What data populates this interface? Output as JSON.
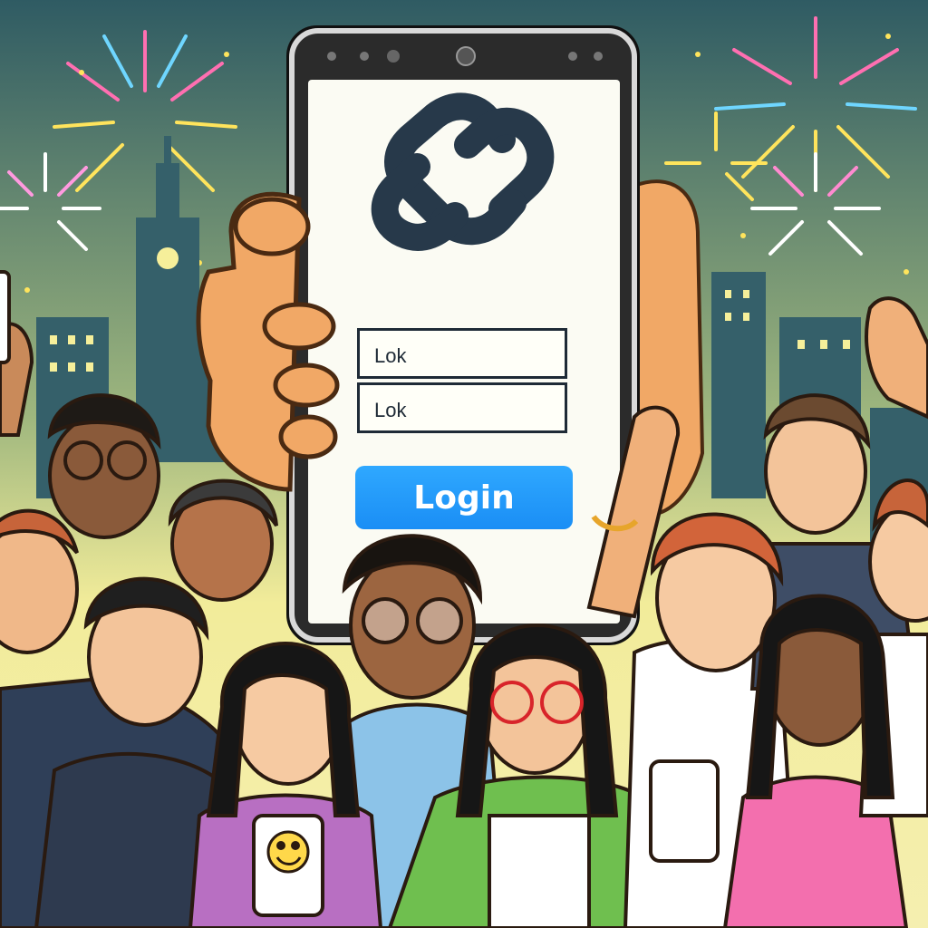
{
  "login": {
    "field_1_value": "Lok",
    "field_2_value": "Lok",
    "button_label": "Login"
  },
  "colors": {
    "sky_top": "#2f5b63",
    "sky_glow": "#f2ec9a",
    "button_blue": "#1a8ef5",
    "phone_frame": "#2b2b2b",
    "screen_bg": "#fbfbf3",
    "logo_navy": "#27394a"
  },
  "icons": {
    "app_logo": "interlinked-loops-logo-icon",
    "phone_emoji": "smiling-face-emoji-icon"
  }
}
